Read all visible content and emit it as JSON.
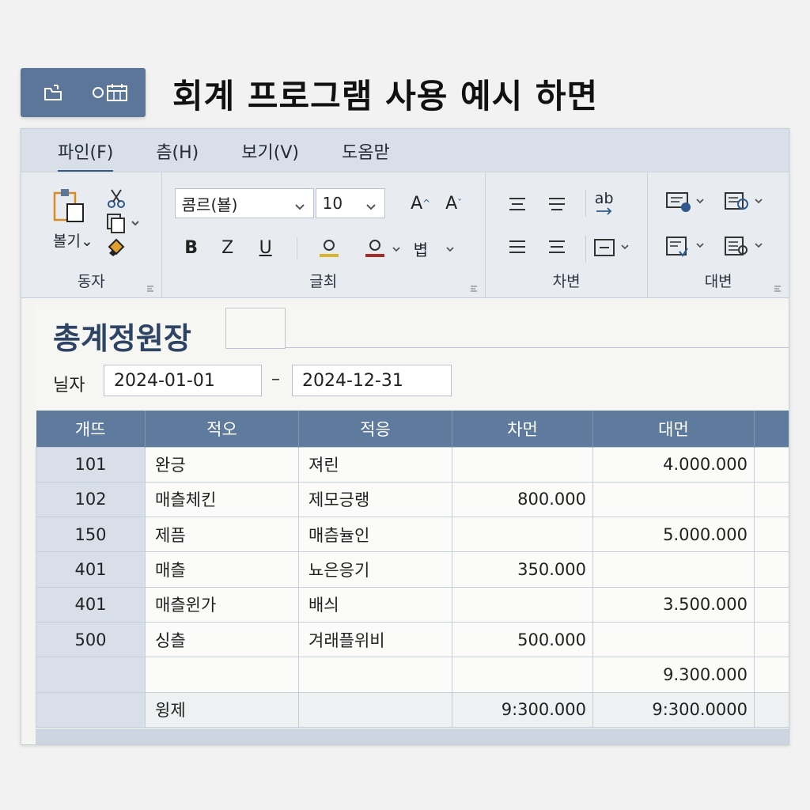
{
  "page_title": "회계 프로그램 사용 예시 하면",
  "menu": {
    "items": [
      "파인(F)",
      "츰(H)",
      "보기(V)",
      "도옴맏"
    ]
  },
  "ribbon": {
    "clipboard": {
      "paste_label": "볼기⌄",
      "group_label": "동자"
    },
    "font": {
      "font_name": "콤르(뵬)",
      "font_size": "10",
      "grow_label": "A",
      "shrink_label": "A",
      "bold": "B",
      "italic": "Z",
      "underline": "U",
      "style_label": "볍",
      "group_label": "글최"
    },
    "alignment": {
      "wrap_label": "ab",
      "group_label": "차변"
    },
    "cells": {
      "group_label": "대변"
    }
  },
  "sheet": {
    "title": "총계정원장",
    "date_label": "닐자",
    "date_from": "2024-01-01",
    "date_separator": "–",
    "date_to": "2024-12-31"
  },
  "table": {
    "headers": [
      "개뜨",
      "적오",
      "적응",
      "차먼",
      "대먼"
    ],
    "rows": [
      {
        "code": "101",
        "summary": "완긍",
        "account": "져린",
        "debit": "",
        "credit": "4.000.000"
      },
      {
        "code": "102",
        "summary": "매츨체킨",
        "account": "제모긍랭",
        "debit": "800.000",
        "credit": ""
      },
      {
        "code": "150",
        "summary": "제픔",
        "account": "매츰뉼인",
        "debit": "",
        "credit": "5.000.000"
      },
      {
        "code": "401",
        "summary": "매츨",
        "account": "뇨은응기",
        "debit": "350.000",
        "credit": ""
      },
      {
        "code": "401",
        "summary": "매츨윈가",
        "account": "배싀",
        "debit": "",
        "credit": "3.500.000"
      },
      {
        "code": "500",
        "summary": "싱츨",
        "account": "겨래플위비",
        "debit": "500.000",
        "credit": ""
      },
      {
        "code": "",
        "summary": "",
        "account": "",
        "debit": "",
        "credit": "9.300.000"
      }
    ],
    "total": {
      "summary": "윙제",
      "debit": "9:300.000",
      "credit": "9:300.0000"
    }
  },
  "colors": {
    "header_bg": "#5e7a9d",
    "badge_bg": "#5b7699",
    "title_text": "#2e4464",
    "code_col_bg": "#d8dfe8"
  }
}
